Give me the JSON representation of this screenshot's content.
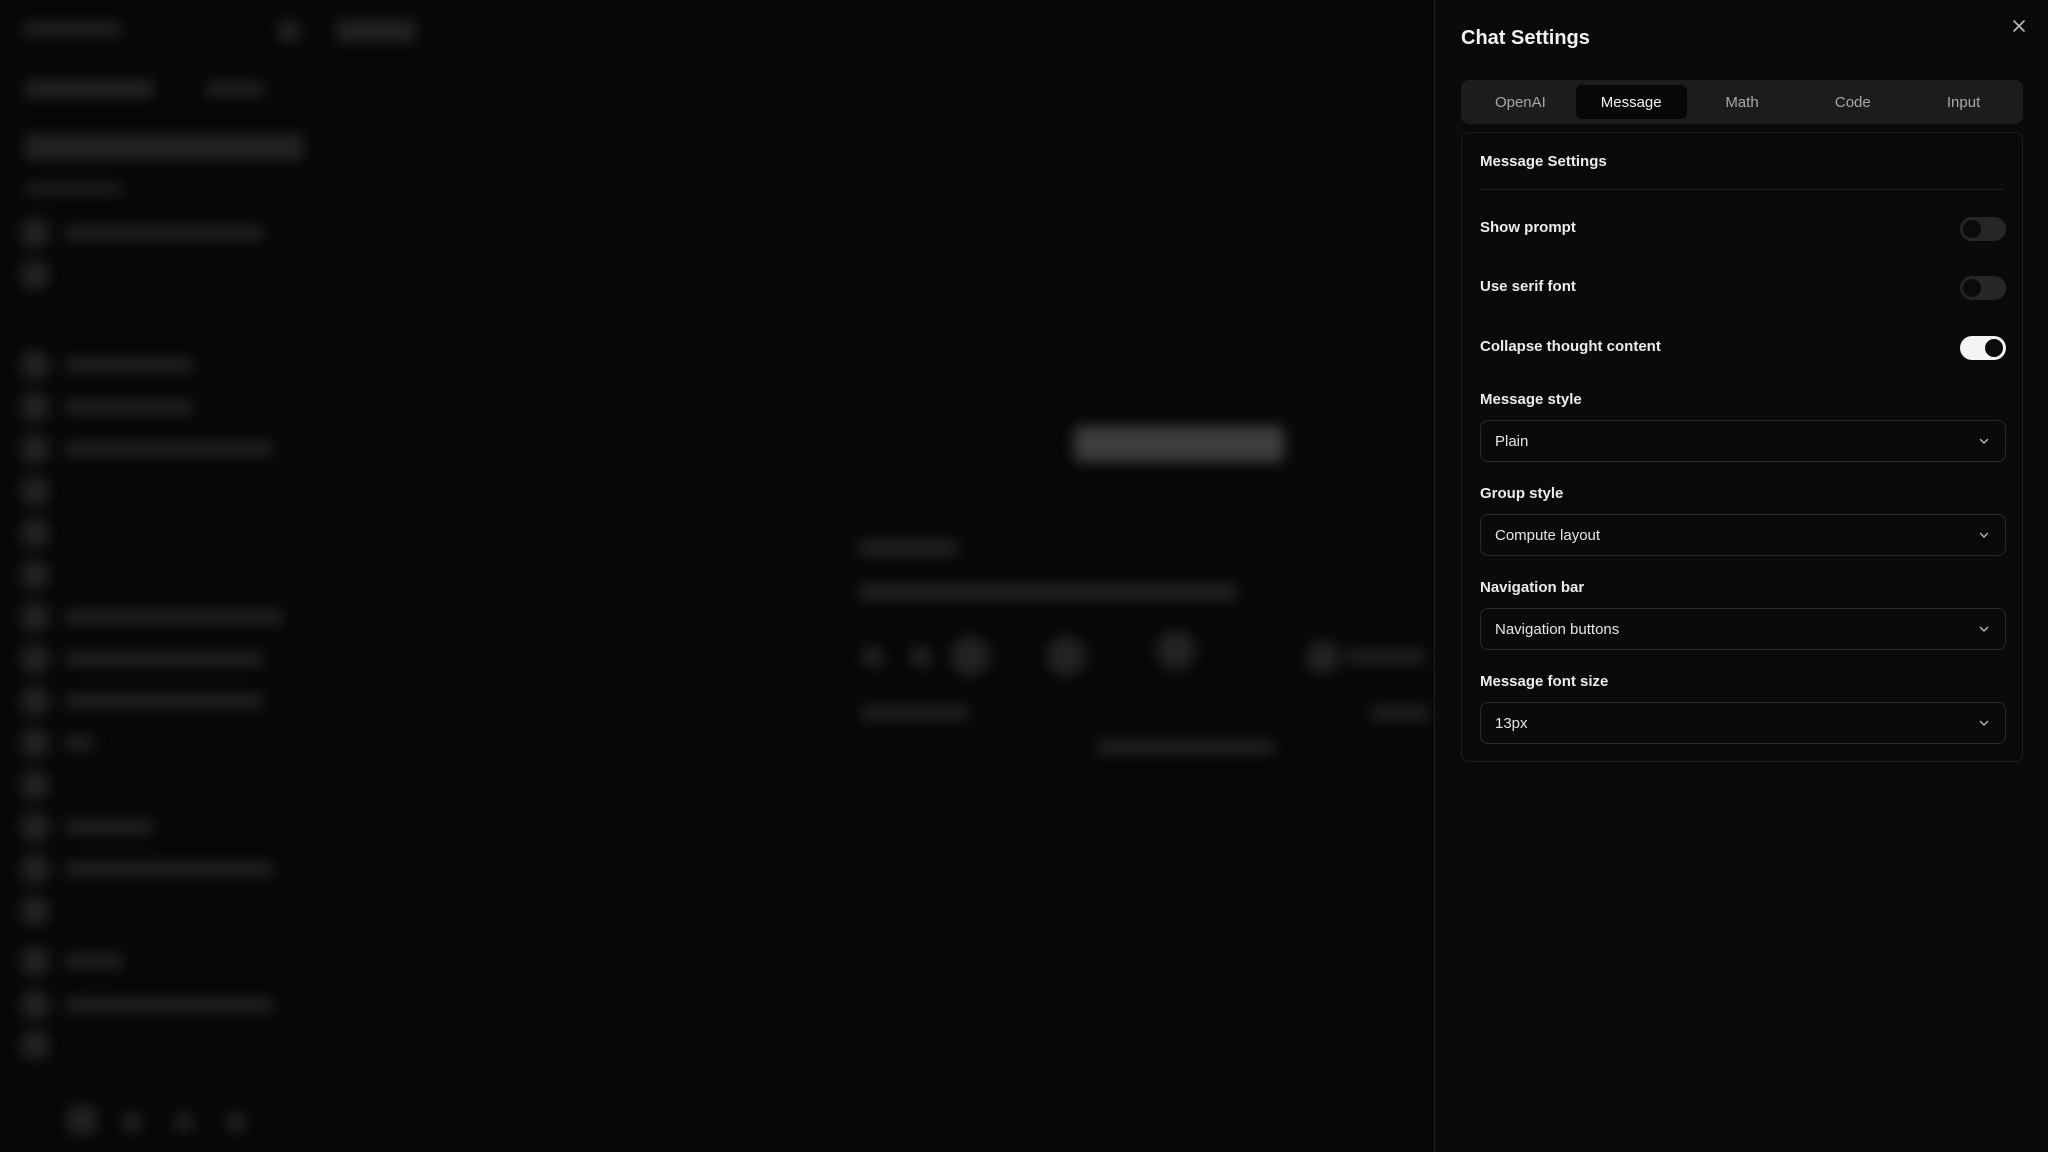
{
  "panel": {
    "title": "Chat Settings",
    "tabs": [
      {
        "label": "OpenAI",
        "active": false
      },
      {
        "label": "Message",
        "active": true
      },
      {
        "label": "Math",
        "active": false
      },
      {
        "label": "Code",
        "active": false
      },
      {
        "label": "Input",
        "active": false
      }
    ],
    "section_title": "Message Settings",
    "toggles": [
      {
        "label": "Show prompt",
        "on": false
      },
      {
        "label": "Use serif font",
        "on": false
      },
      {
        "label": "Collapse thought content",
        "on": true
      }
    ],
    "selects": [
      {
        "label": "Message style",
        "value": "Plain"
      },
      {
        "label": "Group style",
        "value": "Compute layout"
      },
      {
        "label": "Navigation bar",
        "value": "Navigation buttons"
      },
      {
        "label": "Message font size",
        "value": "13px"
      }
    ]
  },
  "icons": {
    "close": "close-icon",
    "chevron": "chevron-down-icon"
  },
  "colors": {
    "background": "#060606",
    "panel": "#0a0a0a",
    "tabs_bg": "#1c1c1c",
    "toggle_on": "#f4f4f4",
    "toggle_off": "#262626"
  }
}
